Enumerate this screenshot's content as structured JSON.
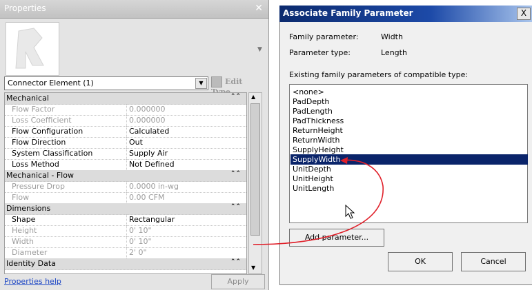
{
  "properties_panel": {
    "title": "Properties",
    "close_glyph": "✕",
    "type_selector": "Connector Element (1)",
    "edit_type_label": "Edit Type",
    "groups": [
      {
        "label": "Mechanical",
        "rows": [
          {
            "name": "Flow Factor",
            "value": "0.000000"
          },
          {
            "name": "Loss Coefficient",
            "value": "0.000000"
          },
          {
            "name": "Flow Configuration",
            "value": "Calculated"
          },
          {
            "name": "Flow Direction",
            "value": "Out"
          },
          {
            "name": "System Classification",
            "value": "Supply Air"
          },
          {
            "name": "Loss Method",
            "value": "Not Defined"
          }
        ]
      },
      {
        "label": "Mechanical - Flow",
        "rows": [
          {
            "name": "Pressure Drop",
            "value": "0.0000 in-wg"
          },
          {
            "name": "Flow",
            "value": "0.00 CFM"
          }
        ]
      },
      {
        "label": "Dimensions",
        "rows": [
          {
            "name": "Shape",
            "value": "Rectangular"
          },
          {
            "name": "Height",
            "value": "0'  10\""
          },
          {
            "name": "Width",
            "value": "0'  10\""
          },
          {
            "name": "Diameter",
            "value": "2'  0\""
          }
        ]
      },
      {
        "label": "Identity Data",
        "rows": []
      }
    ],
    "help_link": "Properties help",
    "apply_button": "Apply"
  },
  "dialog": {
    "title": "Associate Family Parameter",
    "close_glyph": "X",
    "family_parameter_label": "Family parameter:",
    "family_parameter_value": "Width",
    "parameter_type_label": "Parameter type:",
    "parameter_type_value": "Length",
    "list_label": "Existing family parameters of compatible type:",
    "parameters": [
      "<none>",
      "PadDepth",
      "PadLength",
      "PadThickness",
      "ReturnHeight",
      "ReturnWidth",
      "SupplyHeight",
      "SupplyWidth",
      "UnitDepth",
      "UnitHeight",
      "UnitLength"
    ],
    "selected_parameter": "SupplyWidth",
    "add_parameter_button": "Add parameter...",
    "ok_button": "OK",
    "cancel_button": "Cancel"
  },
  "colors": {
    "selection": "#0a246a",
    "annotation_arrow": "#e0202a",
    "link": "#1a44c4"
  }
}
